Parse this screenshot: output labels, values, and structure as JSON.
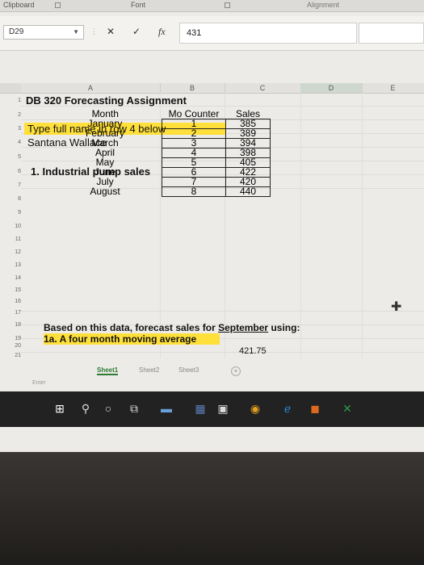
{
  "ribbon": {
    "groups": [
      "Clipboard",
      "Font",
      "Alignment"
    ]
  },
  "formula_bar": {
    "name_box": "D29",
    "cancel_glyph": "✕",
    "enter_glyph": "✓",
    "fx_glyph": "fx",
    "value": "431"
  },
  "columns": [
    "A",
    "B",
    "C",
    "D",
    "E"
  ],
  "rows": [
    "1",
    "2",
    "3",
    "4",
    "5",
    "6",
    "7",
    "8",
    "9",
    "10",
    "11",
    "12",
    "13",
    "14",
    "15",
    "16",
    "17",
    "18",
    "19",
    "20",
    "21"
  ],
  "sheet": {
    "title": "DB 320 Forecasting Assignment",
    "instruction": "Type full name in row 4 below",
    "name": "Santana Wallace",
    "section": "1. Industrial pump sales",
    "table_headers": {
      "month": "Month",
      "counter": "Mo Counter",
      "sales": "Sales"
    },
    "table_rows": [
      {
        "month": "January",
        "counter": "1",
        "sales": "385"
      },
      {
        "month": "February",
        "counter": "2",
        "sales": "389"
      },
      {
        "month": "March",
        "counter": "3",
        "sales": "394"
      },
      {
        "month": "April",
        "counter": "4",
        "sales": "398"
      },
      {
        "month": "May",
        "counter": "5",
        "sales": "405"
      },
      {
        "month": "June",
        "counter": "6",
        "sales": "422"
      },
      {
        "month": "July",
        "counter": "7",
        "sales": "420"
      },
      {
        "month": "August",
        "counter": "8",
        "sales": "440"
      }
    ],
    "question_prefix": "Based on this data, forecast sales for ",
    "question_month": "September",
    "question_suffix": " using:",
    "subq": "1a. A four month moving average",
    "answer": "421.75"
  },
  "tabs": [
    "Sheet1",
    "Sheet2",
    "Sheet3"
  ],
  "add_sheet_glyph": "+",
  "status": "Enter",
  "colors": {
    "highlight": "#ffe03a",
    "active_tab": "#2d7b34"
  }
}
